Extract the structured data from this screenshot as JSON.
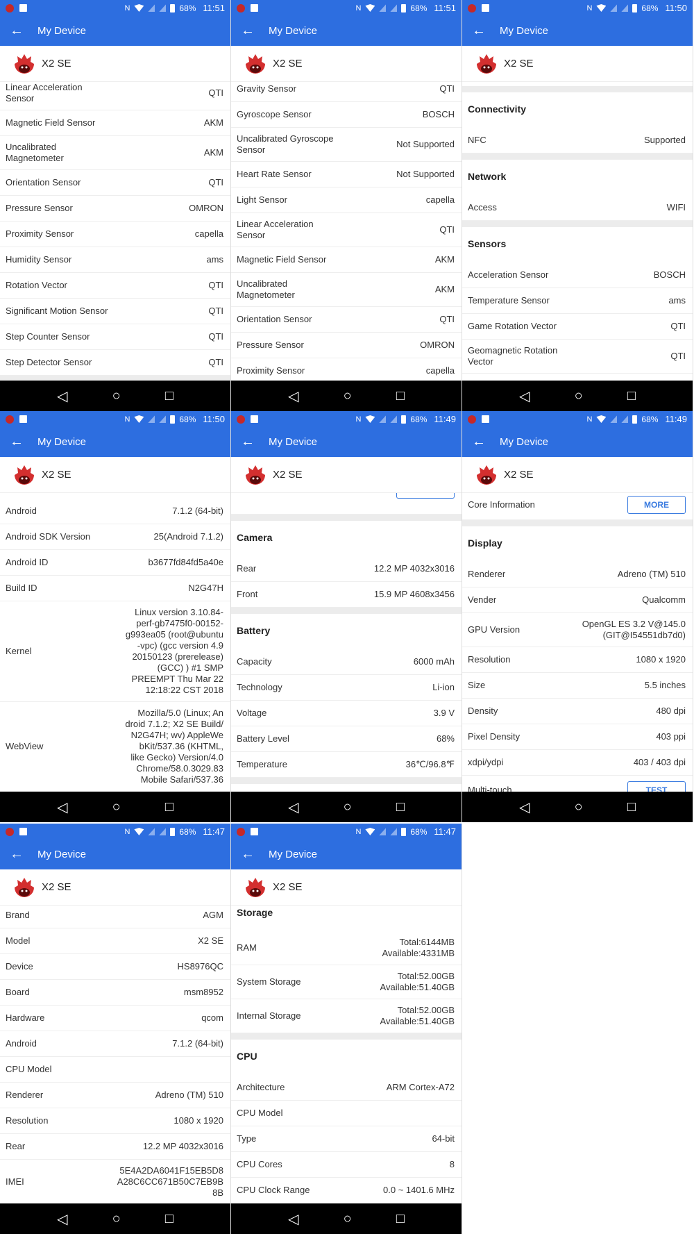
{
  "app": {
    "title": "My Device",
    "device": "X2 SE",
    "battery": "68%"
  },
  "colors": {
    "primary": "#2d6ee0",
    "nav": "#000000",
    "section_gap": "#ececec"
  },
  "panels": [
    {
      "time": "11:51",
      "offset": -8,
      "rows": [
        {
          "t": "row",
          "label": "Linear Acceleration\nSensor",
          "value": "QTI"
        },
        {
          "t": "row",
          "label": "Magnetic Field Sensor",
          "value": "AKM"
        },
        {
          "t": "row",
          "label": "Uncalibrated\nMagnetometer",
          "value": "AKM"
        },
        {
          "t": "row",
          "label": "Orientation Sensor",
          "value": "QTI"
        },
        {
          "t": "row",
          "label": "Pressure Sensor",
          "value": "OMRON"
        },
        {
          "t": "row",
          "label": "Proximity Sensor",
          "value": "capella"
        },
        {
          "t": "row",
          "label": "Humidity Sensor",
          "value": "ams"
        },
        {
          "t": "row",
          "label": "Rotation Vector",
          "value": "QTI"
        },
        {
          "t": "row",
          "label": "Significant Motion Sensor",
          "value": "QTI"
        },
        {
          "t": "row",
          "label": "Step Counter Sensor",
          "value": "QTI"
        },
        {
          "t": "row",
          "label": "Step Detector Sensor",
          "value": "QTI"
        },
        {
          "t": "gap"
        }
      ]
    },
    {
      "time": "11:51",
      "offset": -8,
      "rows": [
        {
          "t": "row",
          "label": "Gravity Sensor",
          "value": "QTI"
        },
        {
          "t": "row",
          "label": "Gyroscope Sensor",
          "value": "BOSCH"
        },
        {
          "t": "row",
          "label": "Uncalibrated Gyroscope\nSensor",
          "value": "Not Supported"
        },
        {
          "t": "row",
          "label": "Heart Rate Sensor",
          "value": "Not Supported"
        },
        {
          "t": "row",
          "label": "Light Sensor",
          "value": "capella"
        },
        {
          "t": "row",
          "label": "Linear Acceleration\nSensor",
          "value": "QTI"
        },
        {
          "t": "row",
          "label": "Magnetic Field Sensor",
          "value": "AKM"
        },
        {
          "t": "row",
          "label": "Uncalibrated\nMagnetometer",
          "value": "AKM"
        },
        {
          "t": "row",
          "label": "Orientation Sensor",
          "value": "QTI"
        },
        {
          "t": "row",
          "label": "Pressure Sensor",
          "value": "OMRON"
        },
        {
          "t": "row",
          "label": "Proximity Sensor",
          "value": "capella"
        }
      ]
    },
    {
      "time": "11:50",
      "offset": 6,
      "rows": [
        {
          "t": "gap"
        },
        {
          "t": "hdr",
          "label": "Connectivity"
        },
        {
          "t": "row",
          "label": "NFC",
          "value": "Supported"
        },
        {
          "t": "gap"
        },
        {
          "t": "hdr",
          "label": "Network"
        },
        {
          "t": "row",
          "label": "Access",
          "value": "WIFI"
        },
        {
          "t": "gap"
        },
        {
          "t": "hdr",
          "label": "Sensors"
        },
        {
          "t": "row",
          "label": "Acceleration Sensor",
          "value": "BOSCH"
        },
        {
          "t": "row",
          "label": "Temperature Sensor",
          "value": "ams"
        },
        {
          "t": "row",
          "label": "Game Rotation Vector",
          "value": "QTI"
        },
        {
          "t": "row",
          "label": "Geomagnetic Rotation\nVector",
          "value": "QTI"
        }
      ]
    },
    {
      "time": "11:50",
      "offset": 8,
      "rows": [
        {
          "t": "row",
          "label": "Android",
          "value": "7.1.2 (64-bit)"
        },
        {
          "t": "row",
          "label": "Android SDK Version",
          "value": "25(Android 7.1.2)"
        },
        {
          "t": "row",
          "label": "Android ID",
          "value": "b3677fd84fd5a40e"
        },
        {
          "t": "row",
          "label": "Build ID",
          "value": "N2G47H"
        },
        {
          "t": "row",
          "label": "Kernel",
          "value": "Linux version 3.10.84-\nperf-gb7475f0-00152-\ng993ea05 (root@ubuntu\n-vpc) (gcc version 4.9\n20150123 (prerelease)\n(GCC) ) #1 SMP\nPREEMPT Thu Mar 22\n12:18:22 CST 2018"
        },
        {
          "t": "row",
          "label": "WebView",
          "value": "Mozilla/5.0 (Linux; An\ndroid 7.1.2; X2 SE Build/\nN2G47H; wv) AppleWe\nbKit/537.36 (KHTML,\nlike Gecko) Version/4.0\nChrome/58.0.3029.83\nMobile Safari/537.36"
        }
      ]
    },
    {
      "time": "11:49",
      "offset": -6,
      "rows": [
        {
          "t": "btnrow",
          "label": "",
          "button": ""
        },
        {
          "t": "gap"
        },
        {
          "t": "hdr",
          "label": "Camera"
        },
        {
          "t": "row",
          "label": "Rear",
          "value": "12.2 MP 4032x3016"
        },
        {
          "t": "row",
          "label": "Front",
          "value": "15.9 MP 4608x3456"
        },
        {
          "t": "gap"
        },
        {
          "t": "hdr",
          "label": "Battery"
        },
        {
          "t": "row",
          "label": "Capacity",
          "value": "6000 mAh"
        },
        {
          "t": "row",
          "label": "Technology",
          "value": "Li-ion"
        },
        {
          "t": "row",
          "label": "Voltage",
          "value": "3.9 V"
        },
        {
          "t": "row",
          "label": "Battery Level",
          "value": "68%"
        },
        {
          "t": "row",
          "label": "Temperature",
          "value": "36℃/96.8℉"
        },
        {
          "t": "gap"
        }
      ]
    },
    {
      "time": "11:49",
      "offset": -4,
      "rows": [
        {
          "t": "btnrow",
          "label": "Core Information",
          "button": "MORE"
        },
        {
          "t": "gap"
        },
        {
          "t": "hdr",
          "label": "Display"
        },
        {
          "t": "row",
          "label": "Renderer",
          "value": "Adreno (TM) 510"
        },
        {
          "t": "row",
          "label": "Vender",
          "value": "Qualcomm"
        },
        {
          "t": "row",
          "label": "GPU Version",
          "value": "OpenGL ES 3.2 V@145.0\n(GIT@I54551db7d0)"
        },
        {
          "t": "row",
          "label": "Resolution",
          "value": "1080 x 1920"
        },
        {
          "t": "row",
          "label": "Size",
          "value": "5.5 inches"
        },
        {
          "t": "row",
          "label": "Density",
          "value": "480 dpi"
        },
        {
          "t": "row",
          "label": "Pixel Density",
          "value": "403 ppi"
        },
        {
          "t": "row",
          "label": "xdpi/ydpi",
          "value": "403 / 403 dpi"
        },
        {
          "t": "btnrow",
          "label": "Multi-touch",
          "button": "TEST"
        }
      ]
    },
    {
      "time": "11:47",
      "offset": -4,
      "rows": [
        {
          "t": "row",
          "label": "Brand",
          "value": "AGM"
        },
        {
          "t": "row",
          "label": "Model",
          "value": "X2 SE"
        },
        {
          "t": "row",
          "label": "Device",
          "value": "HS8976QC"
        },
        {
          "t": "row",
          "label": "Board",
          "value": "msm8952"
        },
        {
          "t": "row",
          "label": "Hardware",
          "value": "qcom"
        },
        {
          "t": "row",
          "label": "Android",
          "value": "7.1.2 (64-bit)"
        },
        {
          "t": "row",
          "label": "CPU Model",
          "value": ""
        },
        {
          "t": "row",
          "label": "Renderer",
          "value": "Adreno (TM) 510"
        },
        {
          "t": "row",
          "label": "Resolution",
          "value": "1080 x 1920"
        },
        {
          "t": "row",
          "label": "Rear",
          "value": "12.2 MP 4032x3016"
        },
        {
          "t": "row",
          "label": "IMEI",
          "value": "5E4A2DA6041F15EB5D8\nA28C6CC671B50C7EB9B\n8B"
        }
      ]
    },
    {
      "time": "11:47",
      "offset": -14,
      "rows": [
        {
          "t": "hdr",
          "label": "Storage"
        },
        {
          "t": "row",
          "label": "RAM",
          "value": "Total:6144MB\nAvailable:4331MB"
        },
        {
          "t": "row",
          "label": "System Storage",
          "value": "Total:52.00GB\nAvailable:51.40GB"
        },
        {
          "t": "row",
          "label": "Internal Storage",
          "value": "Total:52.00GB\nAvailable:51.40GB"
        },
        {
          "t": "gap"
        },
        {
          "t": "hdr",
          "label": "CPU"
        },
        {
          "t": "row",
          "label": "Architecture",
          "value": "ARM Cortex-A72"
        },
        {
          "t": "row",
          "label": "CPU Model",
          "value": ""
        },
        {
          "t": "row",
          "label": "Type",
          "value": "64-bit"
        },
        {
          "t": "row",
          "label": "CPU Cores",
          "value": "8"
        },
        {
          "t": "row",
          "label": "CPU Clock Range",
          "value": "0.0 ~ 1401.6 MHz"
        }
      ]
    }
  ]
}
